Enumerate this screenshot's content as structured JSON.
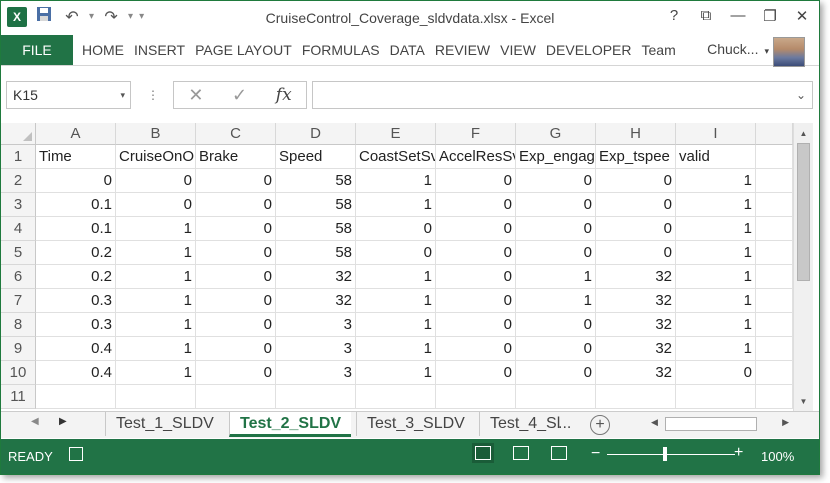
{
  "titlebar": {
    "app_icon": "X",
    "title": "CruiseControl_Coverage_sldvdata.xlsx - Excel",
    "qat": {
      "save": "save-icon",
      "undo": "↶",
      "redo": "↷",
      "customize": "▾"
    },
    "controls": {
      "help": "?",
      "ribbon_display": "⧉",
      "minimize": "—",
      "restore": "❐",
      "close": "✕"
    }
  },
  "ribbon": {
    "file_label": "FILE",
    "tabs": [
      "HOME",
      "INSERT",
      "PAGE LAYOUT",
      "FORMULAS",
      "DATA",
      "REVIEW",
      "VIEW",
      "DEVELOPER",
      "Team"
    ],
    "user": "Chuck..."
  },
  "formula_bar": {
    "name_box": "K15",
    "cancel": "✕",
    "enter": "✓",
    "fx": "fx",
    "formula": ""
  },
  "sheet": {
    "columns": [
      "A",
      "B",
      "C",
      "D",
      "E",
      "F",
      "G",
      "H",
      "I"
    ],
    "rows": [
      "1",
      "2",
      "3",
      "4",
      "5",
      "6",
      "7",
      "8",
      "9",
      "10",
      "11"
    ],
    "headers": [
      "Time",
      "CruiseOnO",
      "Brake",
      "Speed",
      "CoastSetSv",
      "AccelResSv",
      "Exp_engag",
      "Exp_tspee",
      "valid"
    ],
    "data": [
      [
        "0",
        "0",
        "0",
        "58",
        "1",
        "0",
        "0",
        "0",
        "1"
      ],
      [
        "0.1",
        "0",
        "0",
        "58",
        "1",
        "0",
        "0",
        "0",
        "1"
      ],
      [
        "0.1",
        "1",
        "0",
        "58",
        "0",
        "0",
        "0",
        "0",
        "1"
      ],
      [
        "0.2",
        "1",
        "0",
        "58",
        "0",
        "0",
        "0",
        "0",
        "1"
      ],
      [
        "0.2",
        "1",
        "0",
        "32",
        "1",
        "0",
        "1",
        "32",
        "1"
      ],
      [
        "0.3",
        "1",
        "0",
        "32",
        "1",
        "0",
        "1",
        "32",
        "1"
      ],
      [
        "0.3",
        "1",
        "0",
        "3",
        "1",
        "0",
        "0",
        "32",
        "1"
      ],
      [
        "0.4",
        "1",
        "0",
        "3",
        "1",
        "0",
        "0",
        "32",
        "1"
      ],
      [
        "0.4",
        "1",
        "0",
        "3",
        "1",
        "0",
        "0",
        "32",
        "0"
      ]
    ]
  },
  "sheet_tabs": {
    "tabs": [
      "Test_1_SLDV",
      "Test_2_SLDV",
      "Test_3_SLDV",
      "Test_4_Sl"
    ],
    "active": "Test_2_SLDV",
    "more": "...",
    "add": "+"
  },
  "status": {
    "ready": "READY",
    "zoom": "100%",
    "zoom_minus": "−",
    "zoom_plus": "+"
  },
  "colors": {
    "accent": "#217346"
  }
}
